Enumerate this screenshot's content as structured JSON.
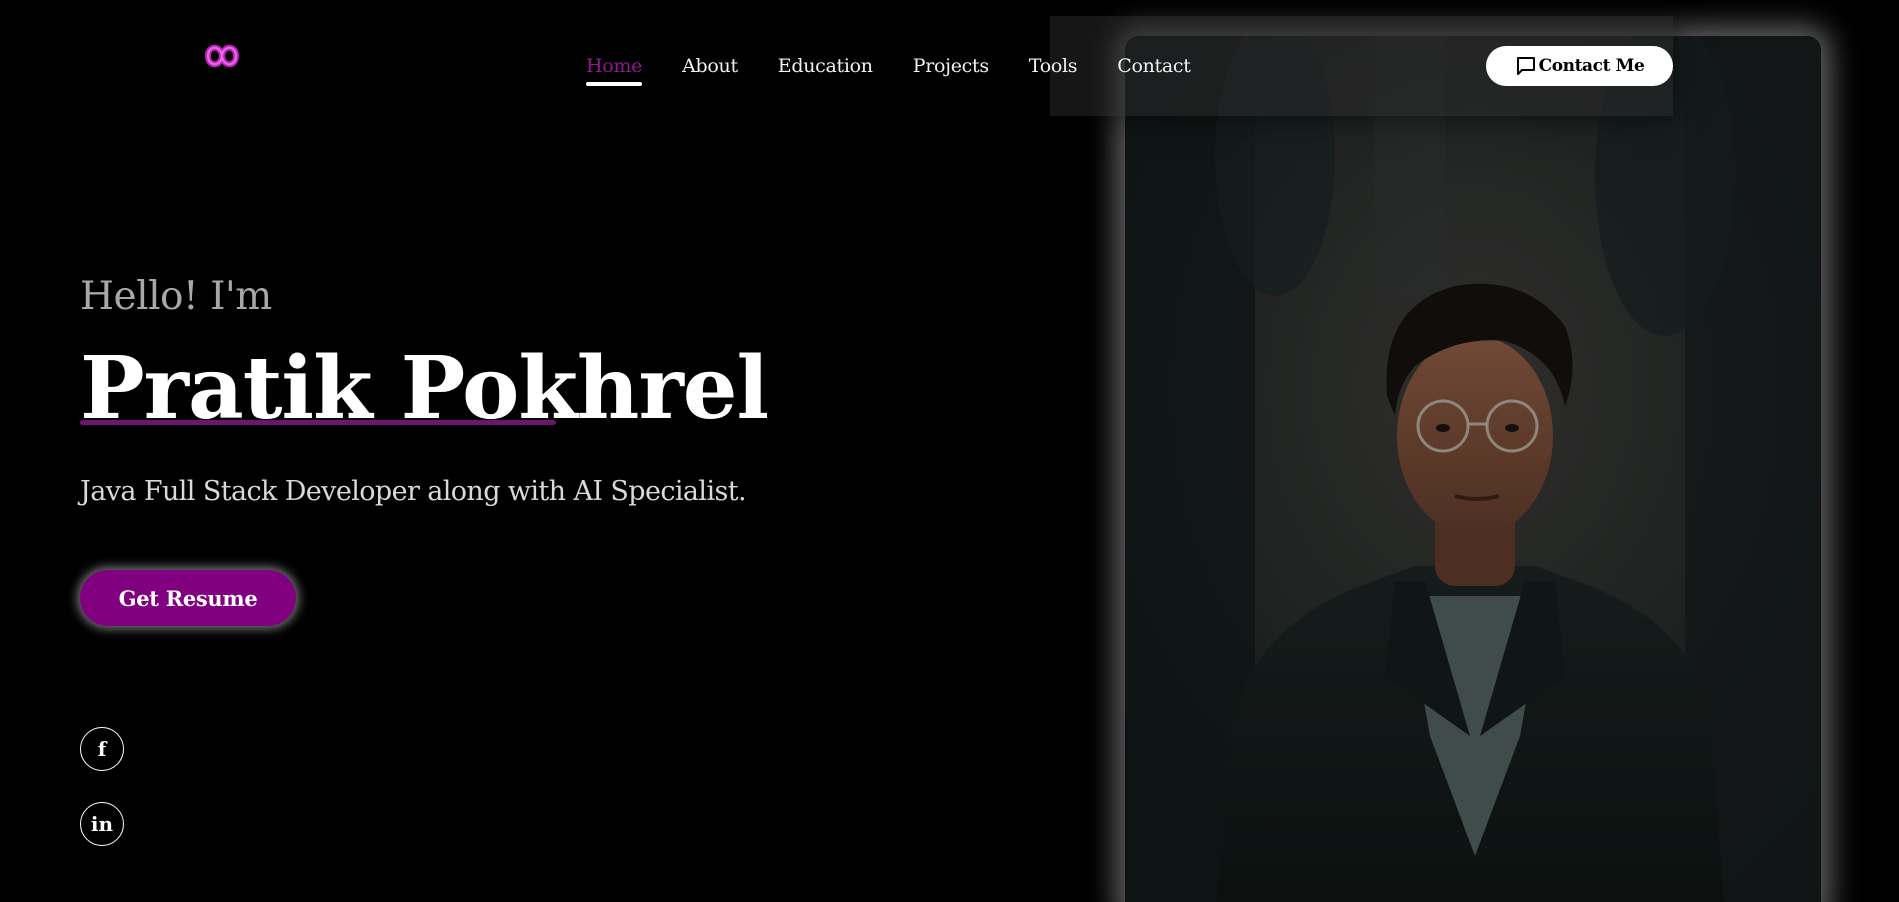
{
  "colors": {
    "background": "#000000",
    "accent_purple": "#800080",
    "active_nav": "#8e1a8e",
    "text_white": "#ffffff"
  },
  "header": {
    "logo_icon": "infinity-icon",
    "nav": [
      {
        "label": "Home",
        "active": true
      },
      {
        "label": "About",
        "active": false
      },
      {
        "label": "Education",
        "active": false
      },
      {
        "label": "Projects",
        "active": false
      },
      {
        "label": "Tools",
        "active": false
      },
      {
        "label": "Contact",
        "active": false
      }
    ],
    "contact_button": {
      "label": "Contact Me",
      "icon": "chat-bubble-icon"
    }
  },
  "hero": {
    "greeting": "Hello! I'm",
    "name": "Pratik Pokhrel",
    "subtitle": "Java Full Stack Developer along with AI Specialist.",
    "resume_button": "Get Resume",
    "socials": [
      {
        "label": "f",
        "icon": "facebook-icon"
      },
      {
        "label": "in",
        "icon": "linkedin-icon"
      }
    ],
    "portrait_icon": "portrait-photo"
  }
}
